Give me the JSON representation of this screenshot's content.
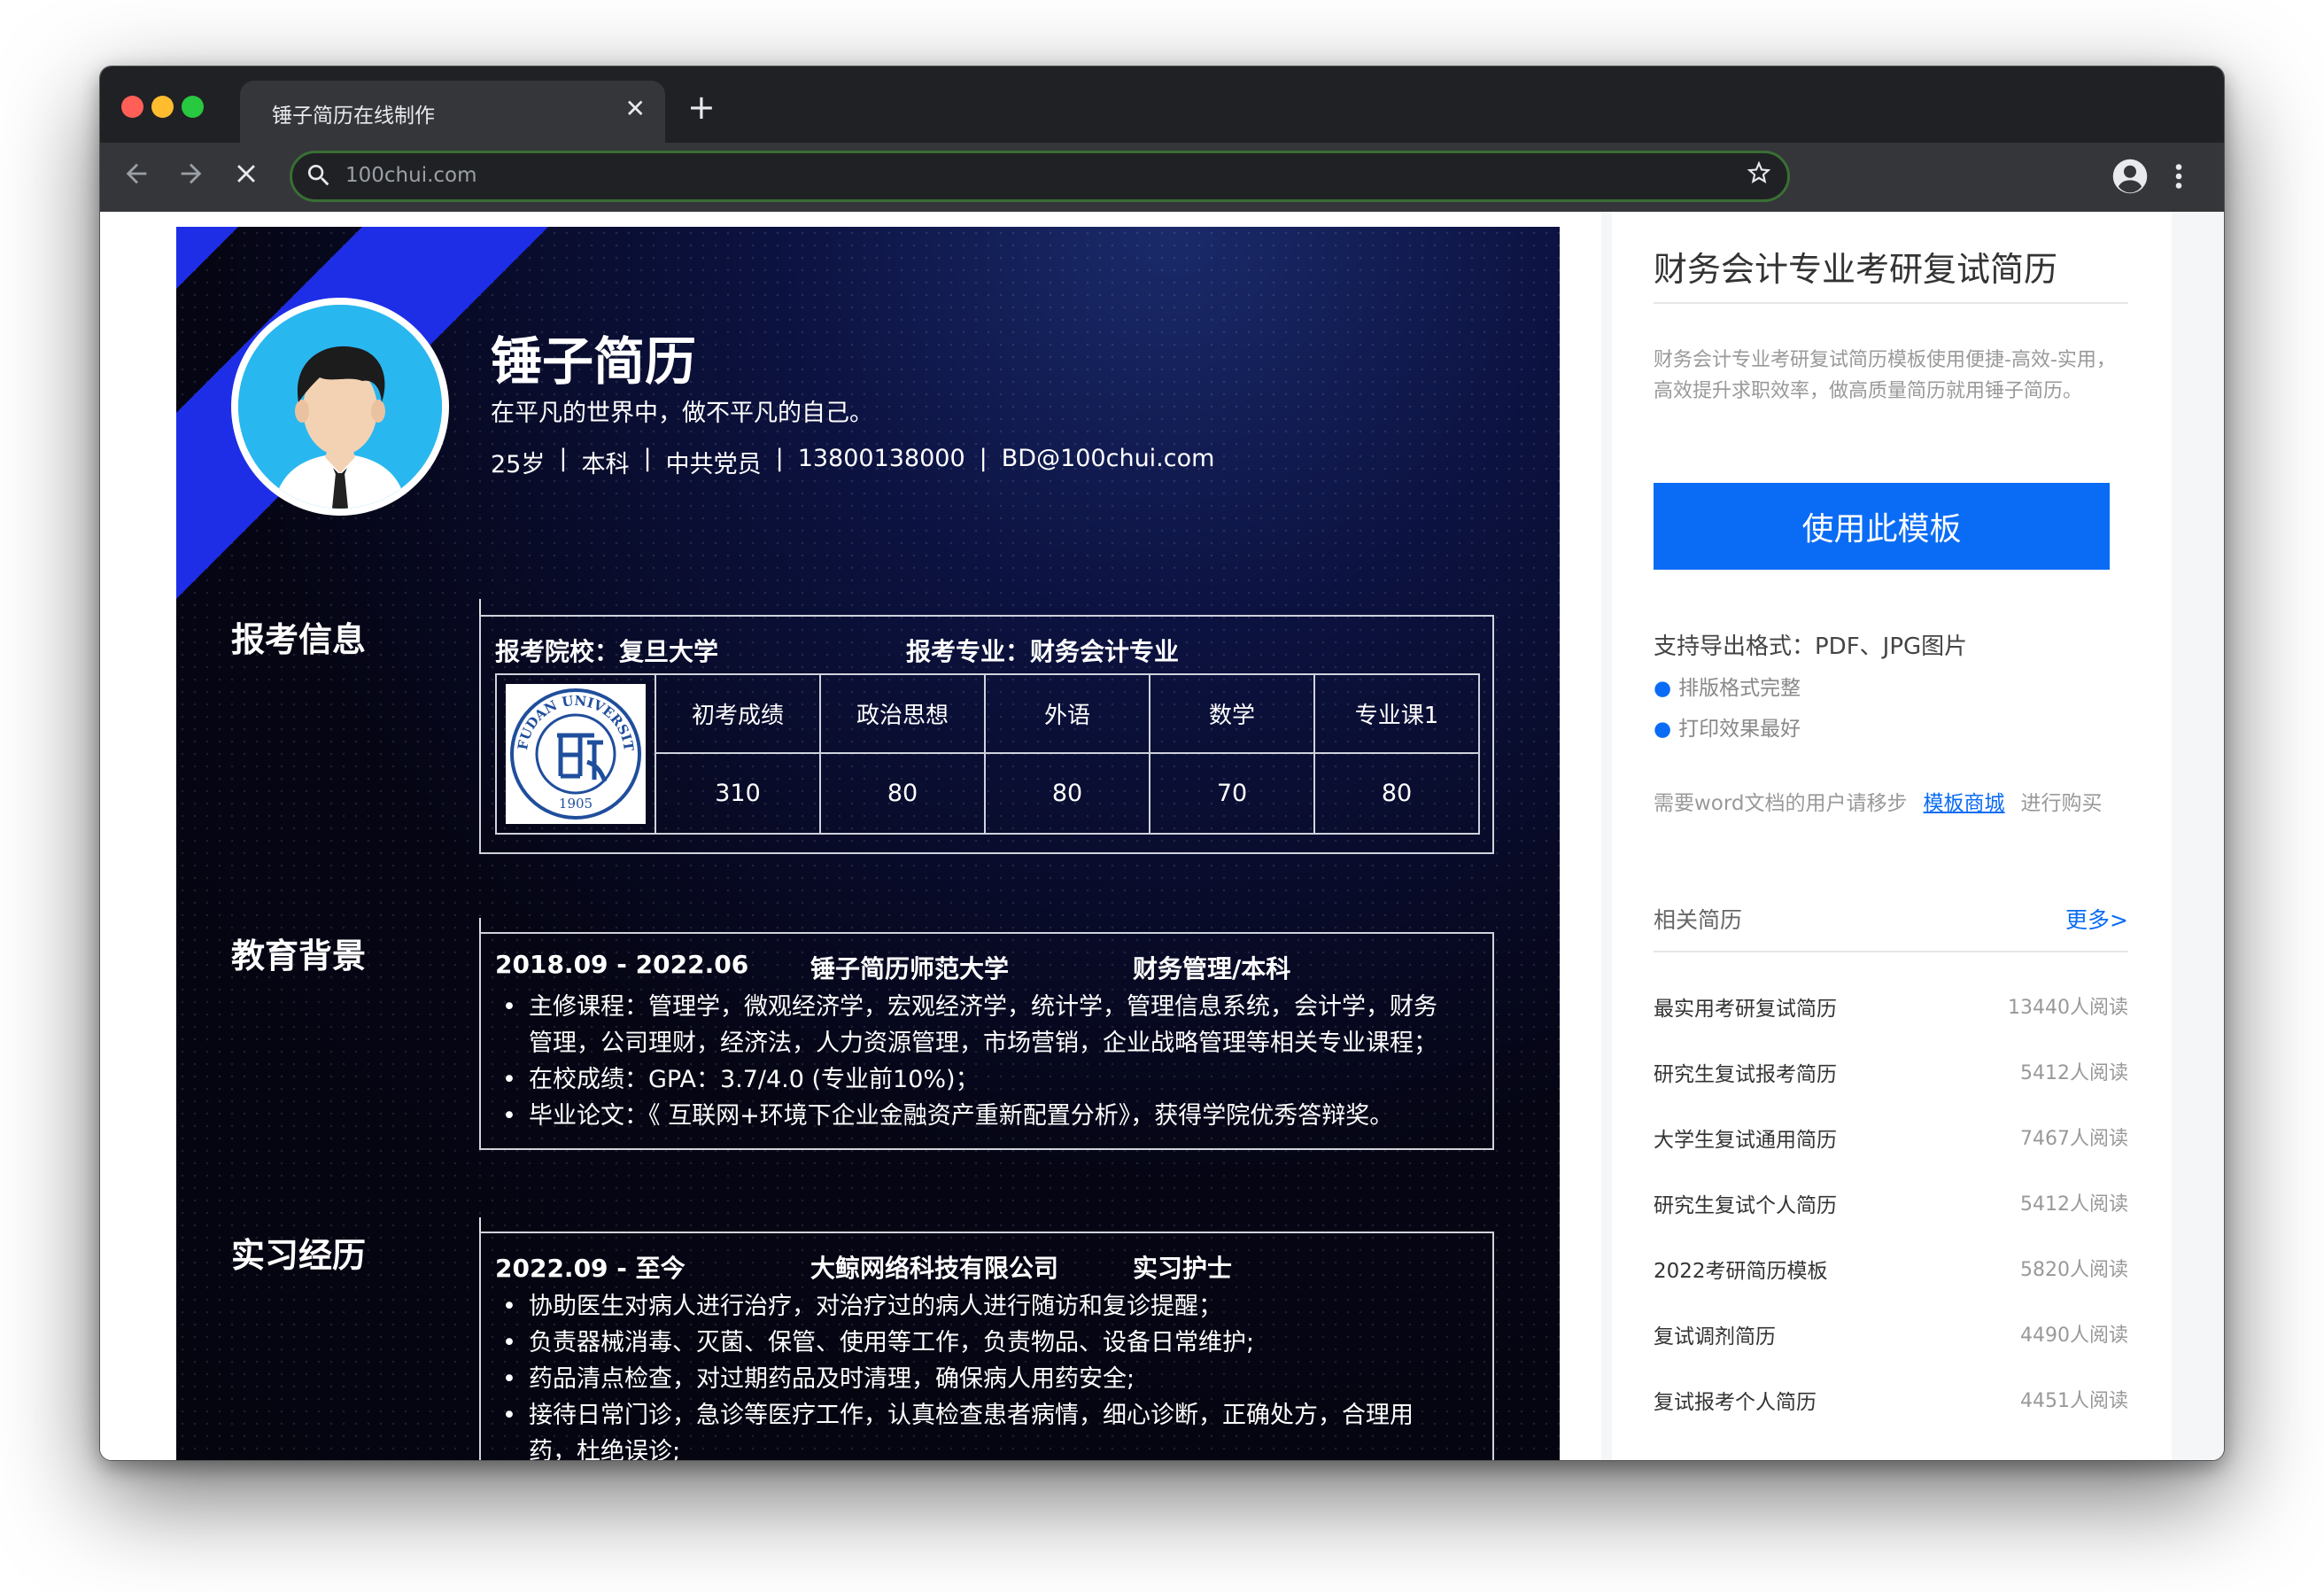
{
  "browser": {
    "tab_title": "锤子简历在线制作",
    "tab_close": "✕",
    "new_tab": "+",
    "url": "100chui.com"
  },
  "resume": {
    "name": "锤子简历",
    "motto": "在平凡的世界中，做不平凡的自己。",
    "info": [
      "25岁",
      "本科",
      "中共党员",
      "13800138000",
      "BD@100chui.com"
    ],
    "separator": "|",
    "sections": {
      "exam": {
        "title": "报考信息",
        "school": "报考院校：复旦大学",
        "major": "报考专业：财务会计专业",
        "score_headers": [
          "初考成绩",
          "政治思想",
          "外语",
          "数学",
          "专业课1"
        ],
        "score_values": [
          "310",
          "80",
          "80",
          "70",
          "80"
        ],
        "logo_text": "FUDAN UNIVERSITY",
        "logo_year": "1905"
      },
      "education": {
        "title": "教育背景",
        "period": "2018.09 - 2022.06",
        "school": "锤子简历师范大学",
        "major": "财务管理/本科",
        "bullets": [
          "主修课程：管理学，微观经济学，宏观经济学，统计学，管理信息系统，会计学，财务管理，公司理财，经济法，人力资源管理，市场营销，企业战略管理等相关专业课程；",
          "在校成绩：GPA：3.7/4.0 (专业前10%)；",
          "毕业论文：《 互联网+环境下企业金融资产重新配置分析》，获得学院优秀答辩奖。"
        ]
      },
      "internship": {
        "title": "实习经历",
        "period": "2022.09 - 至今",
        "company": "大鲸网络科技有限公司",
        "role": "实习护士",
        "bullets": [
          "协助医生对病人进行治疗，对治疗过的病人进行随访和复诊提醒；",
          "负责器械消毒、灭菌、保管、使用等工作，负责物品、设备日常维护;",
          "药品清点检查，对过期药品及时清理，确保病人用药安全;",
          "接待日常门诊，急诊等医疗工作，认真检查患者病情，细心诊断，正确处方，合理用药，杜绝误诊;"
        ]
      }
    }
  },
  "sidebar": {
    "title": "财务会计专业考研复试简历",
    "description": "财务会计专业考研复试简历模板使用便捷-高效-实用，高效提升求职效率，做高质量简历就用锤子简历。",
    "use_button": "使用此模板",
    "export_formats": "支持导出格式：PDF、JPG图片",
    "features": [
      "排版格式完整",
      "打印效果最好"
    ],
    "word_prefix": "需要word文档的用户请移步",
    "word_link": "模板商城",
    "word_suffix": "进行购买",
    "related_title": "相关简历",
    "more": "更多>",
    "related": [
      {
        "name": "最实用考研复试简历",
        "count": "13440人阅读"
      },
      {
        "name": "研究生复试报考简历",
        "count": "5412人阅读"
      },
      {
        "name": "大学生复试通用简历",
        "count": "7467人阅读"
      },
      {
        "name": "研究生复试个人简历",
        "count": "5412人阅读"
      },
      {
        "name": "2022考研简历模板",
        "count": "5820人阅读"
      },
      {
        "name": "复试调剂简历",
        "count": "4490人阅读"
      },
      {
        "name": "复试报考个人简历",
        "count": "4451人阅读"
      }
    ]
  },
  "colors": {
    "accent": "#0a6cf5",
    "stripe": "#1e2ee6",
    "resume_bg": "#050514"
  }
}
